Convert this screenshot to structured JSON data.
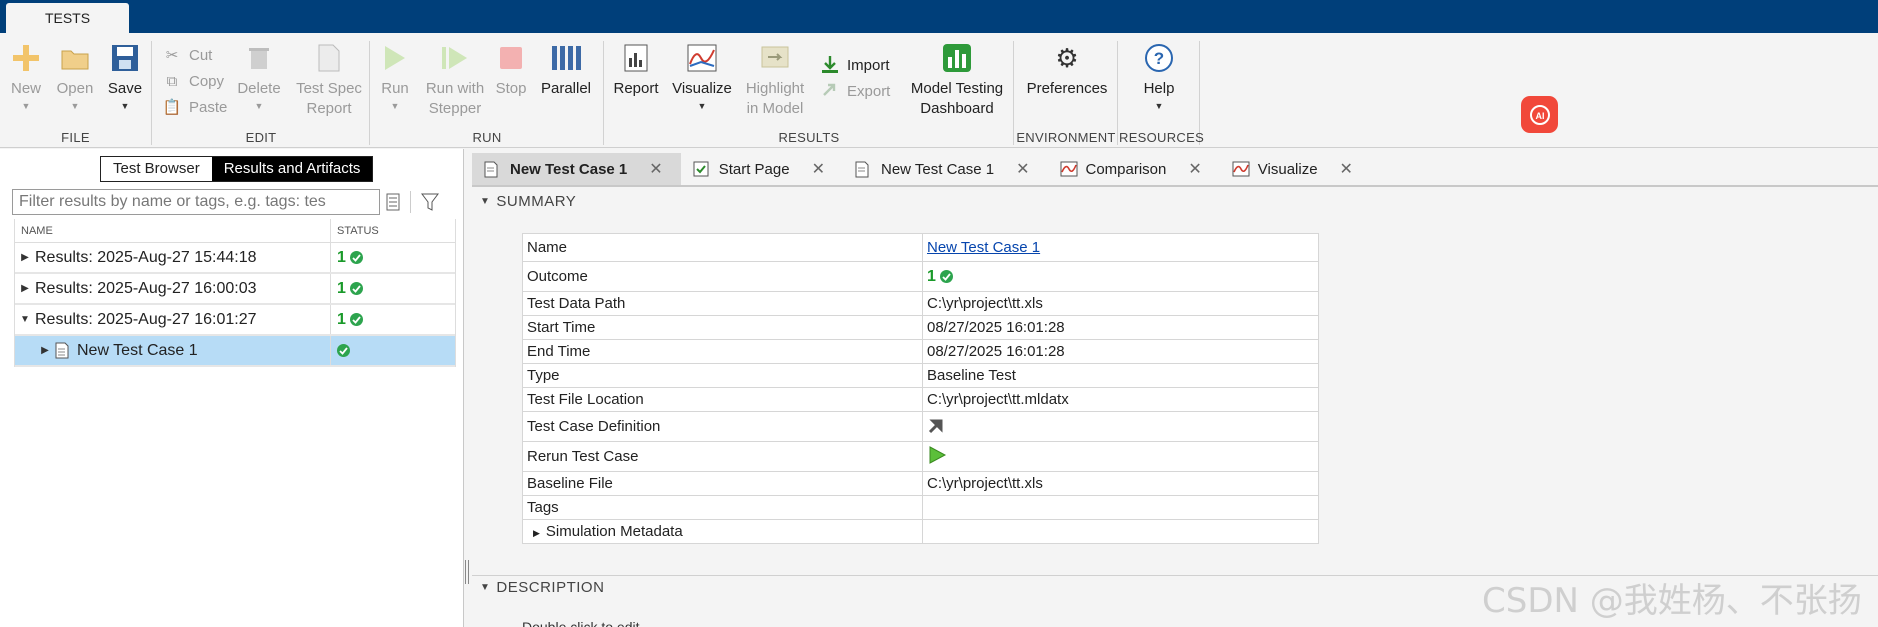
{
  "app": {
    "tab_label": "TESTS"
  },
  "ribbon": {
    "file": {
      "label": "FILE",
      "new": "New",
      "open": "Open",
      "save": "Save"
    },
    "edit": {
      "label": "EDIT",
      "cut": "Cut",
      "copy": "Copy",
      "paste": "Paste",
      "delete": "Delete",
      "spec_line1": "Test Spec",
      "spec_line2": "Report"
    },
    "run": {
      "label": "RUN",
      "run": "Run",
      "stepper_line1": "Run with",
      "stepper_line2": "Stepper",
      "stop": "Stop",
      "parallel": "Parallel"
    },
    "results": {
      "label": "RESULTS",
      "report": "Report",
      "visualize": "Visualize",
      "highlight_line1": "Highlight",
      "highlight_line2": "in Model",
      "import": "Import",
      "export": "Export",
      "mtd_line1": "Model Testing",
      "mtd_line2": "Dashboard"
    },
    "environment": {
      "label": "ENVIRONMENT",
      "preferences": "Preferences"
    },
    "resources": {
      "label": "RESOURCES",
      "help": "Help"
    }
  },
  "left": {
    "toggle": [
      "Test Browser",
      "Results and Artifacts"
    ],
    "filter_placeholder": "Filter results by name or tags, e.g. tags: tes",
    "col_name": "NAME",
    "col_status": "STATUS",
    "rows": [
      {
        "label": "Results: 2025-Aug-27 15:44:18",
        "count": "1"
      },
      {
        "label": "Results: 2025-Aug-27 16:00:03",
        "count": "1"
      },
      {
        "label": "Results: 2025-Aug-27 16:01:27",
        "count": "1"
      },
      {
        "label": "New Test Case 1"
      }
    ]
  },
  "doc_tabs": [
    "New Test Case 1",
    "Start Page",
    "New Test Case 1",
    "Comparison",
    "Visualize"
  ],
  "summary": {
    "title": "SUMMARY",
    "rows": [
      {
        "key": "Name",
        "value": "New Test Case 1"
      },
      {
        "key": "Outcome",
        "value": "1"
      },
      {
        "key": "Test Data Path",
        "value": "C:\\yr\\project\\tt.xls"
      },
      {
        "key": "Start Time",
        "value": "08/27/2025 16:01:28"
      },
      {
        "key": "End Time",
        "value": "08/27/2025 16:01:28"
      },
      {
        "key": "Type",
        "value": "Baseline Test"
      },
      {
        "key": "Test File Location",
        "value": "C:\\yr\\project\\tt.mldatx"
      },
      {
        "key": "Test Case Definition",
        "value": ""
      },
      {
        "key": "Rerun Test Case",
        "value": ""
      },
      {
        "key": "Baseline File",
        "value": "C:\\yr\\project\\tt.xls"
      },
      {
        "key": "Tags",
        "value": ""
      },
      {
        "key": "Simulation Metadata",
        "value": ""
      }
    ]
  },
  "description": {
    "title": "DESCRIPTION",
    "hint": "Double click to edit"
  },
  "watermark": "CSDN @我姓杨、不张扬",
  "colors": {
    "titlebar": "#003f7a",
    "selected_row": "#b7dcf6",
    "pass_green": "#2da44e",
    "ai_button": "#f1483a"
  }
}
